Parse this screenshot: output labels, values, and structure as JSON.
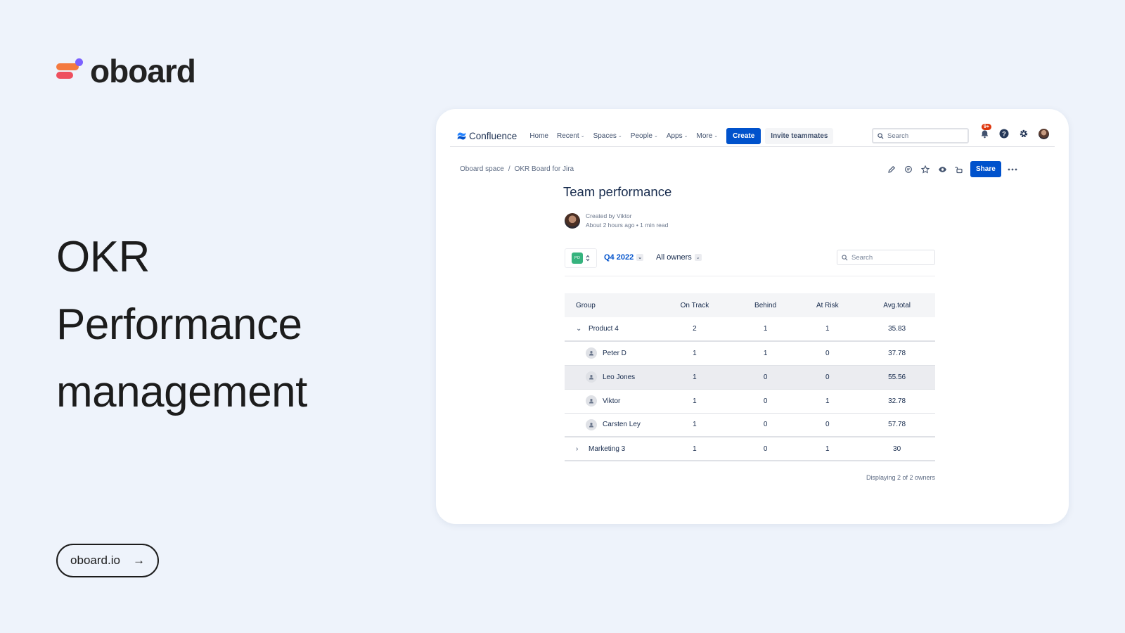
{
  "brand": {
    "name": "oboard"
  },
  "headline": {
    "line1": "OKR",
    "line2": "Performance",
    "line3": "management"
  },
  "site_link": {
    "label": "oboard.io",
    "arrow": "→"
  },
  "confluence": {
    "logo_text": "Confluence",
    "nav": [
      {
        "label": "Home",
        "dropdown": false
      },
      {
        "label": "Recent",
        "dropdown": true
      },
      {
        "label": "Spaces",
        "dropdown": true
      },
      {
        "label": "People",
        "dropdown": true
      },
      {
        "label": "Apps",
        "dropdown": true
      },
      {
        "label": "More",
        "dropdown": true
      }
    ],
    "create_label": "Create",
    "invite_label": "Invite teammates",
    "search_placeholder": "Search",
    "notification_badge": "9+"
  },
  "page": {
    "breadcrumb": [
      "Oboard space",
      "/",
      "OKR Board for Jira"
    ],
    "share_label": "Share",
    "title": "Team performance",
    "created_by": "Created by Viktor",
    "meta": "About 2 hours ago • 1 min read"
  },
  "board": {
    "switcher_badge": "PO",
    "quarter": "Q4 2022",
    "owners_filter": "All owners",
    "search_placeholder": "Search",
    "columns": [
      "Group",
      "On Track",
      "Behind",
      "At Risk",
      "Avg.total"
    ],
    "rows": [
      {
        "type": "group",
        "expanded": true,
        "name": "Product 4",
        "on_track": "2",
        "behind": "1",
        "at_risk": "1",
        "avg_total": "35.83"
      },
      {
        "type": "member",
        "name": "Peter D",
        "on_track": "1",
        "behind": "1",
        "at_risk": "0",
        "avg_total": "37.78"
      },
      {
        "type": "member",
        "name": "Leo Jones",
        "on_track": "1",
        "behind": "0",
        "at_risk": "0",
        "avg_total": "55.56",
        "highlighted": true
      },
      {
        "type": "member",
        "name": "Viktor",
        "on_track": "1",
        "behind": "0",
        "at_risk": "1",
        "avg_total": "32.78"
      },
      {
        "type": "member",
        "name": "Carsten Ley",
        "on_track": "1",
        "behind": "0",
        "at_risk": "0",
        "avg_total": "57.78"
      },
      {
        "type": "group",
        "expanded": false,
        "name": "Marketing 3",
        "on_track": "1",
        "behind": "0",
        "at_risk": "1",
        "avg_total": "30"
      }
    ],
    "footer": "Displaying 2 of 2 owners"
  },
  "colors": {
    "background": "#eef3fb",
    "confluence_blue": "#0052cc",
    "badge_green": "#36b37e",
    "notif_red": "#de350b"
  }
}
